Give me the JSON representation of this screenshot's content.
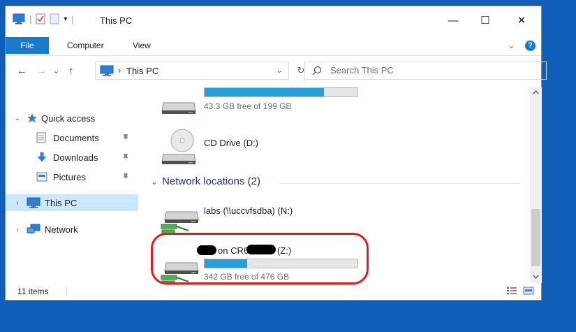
{
  "window": {
    "title": "This PC"
  },
  "titlebar": {
    "separator": "|",
    "dropdown_glyph": "▾"
  },
  "window_controls": {
    "minimize": "—",
    "maximize": "☐",
    "close": "✕"
  },
  "ribbon": {
    "tabs": [
      "File",
      "Computer",
      "View"
    ],
    "expand_glyph": "⌄",
    "help_label": "?"
  },
  "address_bar": {
    "back": "←",
    "forward": "→",
    "recent": "⌄",
    "up": "↑",
    "breadcrumb_sep": "›",
    "location": "This PC",
    "dropdown": "⌄",
    "refresh": "↻",
    "search_placeholder": "Search This PC"
  },
  "nav": {
    "quick_access": "Quick access",
    "items": [
      {
        "label": "Documents",
        "pinned": true
      },
      {
        "label": "Downloads",
        "pinned": true
      },
      {
        "label": "Pictures",
        "pinned": true
      }
    ],
    "this_pc": "This PC",
    "network": "Network",
    "expanded_glyph": "⌄",
    "collapsed_glyph": "›"
  },
  "content": {
    "local_drive": {
      "caption": "43.3 GB free of 199 GB",
      "used_fraction": 0.78
    },
    "cd_drive": {
      "name": "CD Drive (D:)"
    },
    "network_group": {
      "header": "Network locations (2)",
      "chevron": "⌄"
    },
    "network_drives": [
      {
        "name": "labs (\\\\uccvfsdba) (N:)"
      },
      {
        "name_middle": "on CR6",
        "name_end": "(Z:)",
        "caption": "342 GB free of 476 GB",
        "used_fraction": 0.28
      }
    ]
  },
  "status_bar": {
    "item_count": "11 items"
  },
  "colors": {
    "accent": "#1979ca",
    "bar_fill": "#26a0da",
    "selection": "#cce8ff",
    "desktop": "#0f5fb8",
    "annotation": "#e31c1c"
  }
}
